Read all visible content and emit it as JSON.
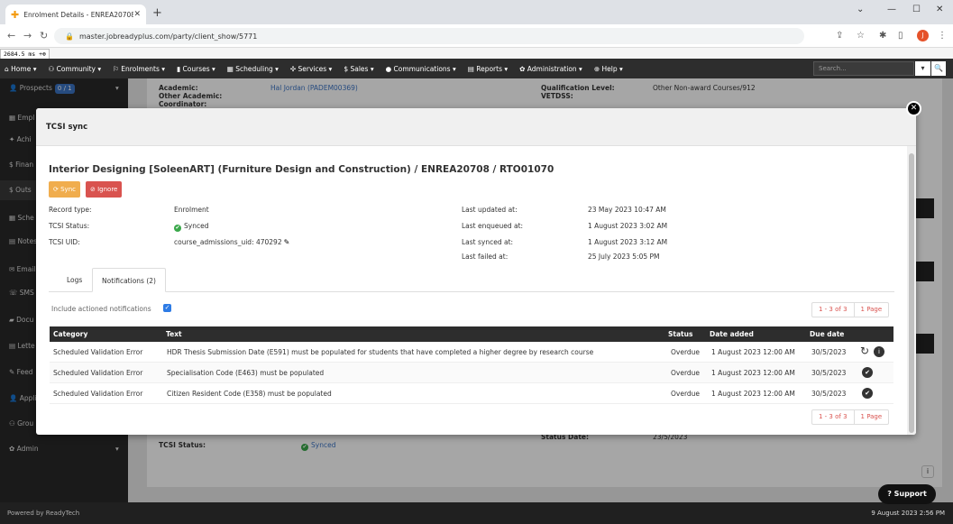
{
  "browser": {
    "tab_title": "Enrolment Details - ENREA20708",
    "url": "master.jobreadyplus.com/party/client_show/5771",
    "timing": "2684.5 ms",
    "avatar_letter": "J"
  },
  "menu": {
    "items": [
      "Home ▾",
      "Community ▾",
      "Enrolments ▾",
      "Courses ▾",
      "Scheduling ▾",
      "Services ▾",
      "Sales ▾",
      "Communications ▾",
      "Reports ▾",
      "Administration ▾",
      "Help ▾"
    ],
    "search_placeholder": "Search..."
  },
  "sidebar": {
    "prospects_label": "Prospects",
    "prospects_badge": "0 / 1",
    "items": [
      "Empl",
      "Achi",
      "Finan",
      "Outs",
      "Sche",
      "Notes",
      "Email",
      "SMS",
      "Docu",
      "Lette",
      "Feed",
      "Appli",
      "Grou",
      "Admin"
    ]
  },
  "background": {
    "academic_label": "Academic:",
    "academic_value": "Hal Jordan (PADEM00369)",
    "other_academic_label": "Other Academic:",
    "coordinator_label": "Coordinator:",
    "qual_level_label": "Qualification Level:",
    "qual_level_value": "Other Non-award Courses/912",
    "vetdss_label": "VETDSS:",
    "tcsi_status_label": "TCSI Status:",
    "tcsi_status_value": "Synced",
    "status_date_label": "Status Date:",
    "status_date_value": "23/5/2023"
  },
  "footer": {
    "powered": "Powered by ReadyTech",
    "datetime": "9 August 2023 2:56 PM",
    "support": "Support"
  },
  "modal": {
    "title": "TCSI sync",
    "record_title": "Interior Designing [SoleenART] (Furniture Design and Construction) / ENREA20708 / RTO01070",
    "sync_label": "Sync",
    "ignore_label": "Ignore",
    "fields_left": [
      {
        "label": "Record type:",
        "value": "Enrolment"
      },
      {
        "label": "TCSI Status:",
        "value": "Synced"
      },
      {
        "label": "TCSI UID:",
        "value": "course_admissions_uid: 470292"
      }
    ],
    "fields_right": [
      {
        "label": "Last updated at:",
        "value": "23 May 2023 10:47 AM"
      },
      {
        "label": "Last enqueued at:",
        "value": "1 August 2023 3:02 AM"
      },
      {
        "label": "Last synced at:",
        "value": "1 August 2023 3:12 AM"
      },
      {
        "label": "Last failed at:",
        "value": "25 July 2023 5:05 PM"
      }
    ],
    "tabs": [
      "Logs",
      "Notifications (2)"
    ],
    "include_actioned": "Include actioned notifications",
    "pager": {
      "range": "1 - 3 of 3",
      "pages": "1 Page"
    },
    "table": {
      "headers": [
        "Category",
        "Text",
        "Status",
        "Date added",
        "Due date"
      ],
      "rows": [
        {
          "category": "Scheduled Validation Error",
          "text": "HDR Thesis Submission Date (E591) must be populated for students that have completed a higher degree by research course",
          "status": "Overdue",
          "date_added": "1 August 2023 12:00 AM",
          "due_date": "30/5/2023"
        },
        {
          "category": "Scheduled Validation Error",
          "text": "Specialisation Code (E463) must be populated",
          "status": "Overdue",
          "date_added": "1 August 2023 12:00 AM",
          "due_date": "30/5/2023"
        },
        {
          "category": "Scheduled Validation Error",
          "text": "Citizen Resident Code (E358) must be populated",
          "status": "Overdue",
          "date_added": "1 August 2023 12:00 AM",
          "due_date": "30/5/2023"
        }
      ]
    }
  }
}
